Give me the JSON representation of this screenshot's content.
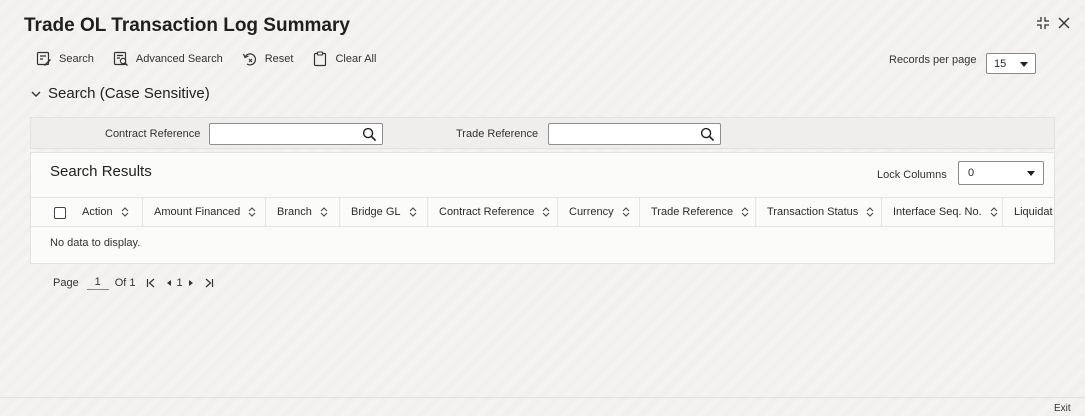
{
  "window": {
    "title": "Trade OL Transaction Log Summary"
  },
  "toolbar": {
    "search_label": "Search",
    "advanced_search_label": "Advanced Search",
    "reset_label": "Reset",
    "clear_all_label": "Clear All"
  },
  "records_per_page": {
    "label": "Records per page",
    "value": "15"
  },
  "search_section": {
    "title": "Search (Case Sensitive)",
    "contract_reference_label": "Contract Reference",
    "contract_reference_value": "",
    "trade_reference_label": "Trade Reference",
    "trade_reference_value": ""
  },
  "results": {
    "title": "Search Results",
    "lock_columns_label": "Lock Columns",
    "lock_columns_value": "0",
    "columns": [
      "Action",
      "Amount Financed",
      "Branch",
      "Bridge GL",
      "Contract Reference",
      "Currency",
      "Trade Reference",
      "Transaction Status",
      "Interface Seq. No.",
      "Liquidat"
    ],
    "empty_message": "No data to display."
  },
  "pager": {
    "page_label": "Page",
    "current_page": "1",
    "of_label": "Of 1",
    "page_number": "1"
  },
  "footer": {
    "exit_label": "Exit"
  }
}
